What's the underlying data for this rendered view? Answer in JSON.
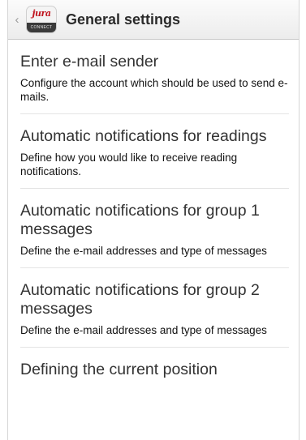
{
  "header": {
    "back_glyph": "‹",
    "logo_brand": "jura",
    "logo_sub": "CONNECT",
    "title": "General settings"
  },
  "settings": [
    {
      "title": "Enter e-mail sender",
      "description": "Configure the account which should be used to send e-mails."
    },
    {
      "title": "Automatic notifications for readings",
      "description": "Define how you would like to receive reading notifications."
    },
    {
      "title": "Automatic notifications for group 1 messages",
      "description": "Define the e-mail addresses and type of messages"
    },
    {
      "title": "Automatic notifications for group 2 messages",
      "description": "Define the e-mail addresses and type of messages"
    },
    {
      "title": "Defining the current position",
      "description": ""
    }
  ],
  "colors": {
    "brand_red": "#c0151f",
    "divider": "#e4e4e4"
  }
}
